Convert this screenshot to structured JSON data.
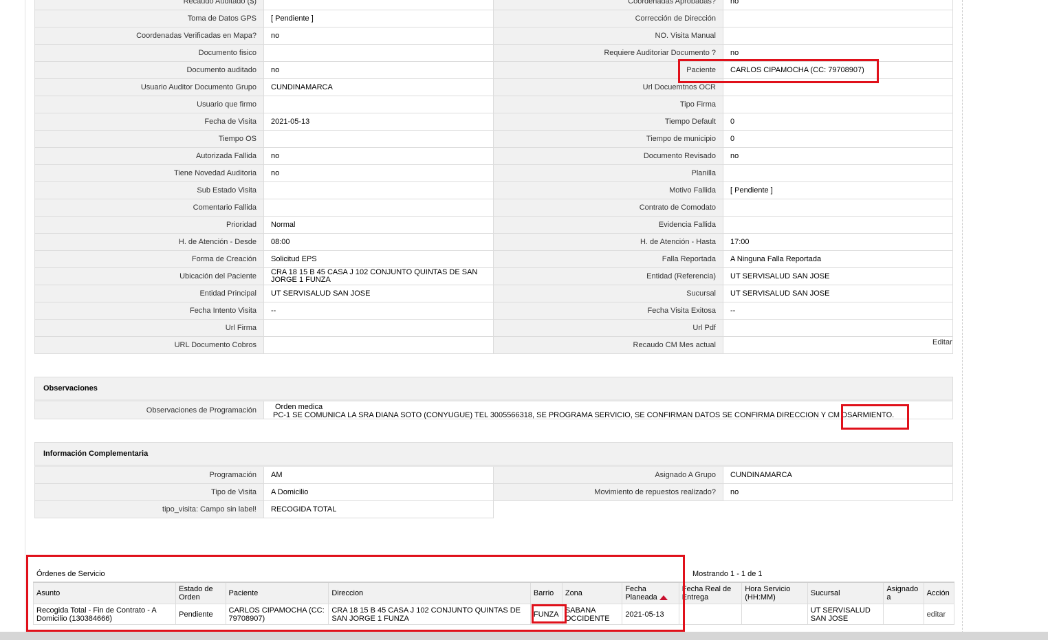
{
  "fields": [
    {
      "l_label": "Recaudo Auditado ($)",
      "l_value": "",
      "r_label": "Coordenadas Aprobadas?",
      "r_value": "no"
    },
    {
      "l_label": "Toma de Datos GPS",
      "l_value": "[ Pendiente ]",
      "r_label": "Corrección de Dirección",
      "r_value": ""
    },
    {
      "l_label": "Coordenadas Verificadas en Mapa?",
      "l_value": "no",
      "r_label": "NO. Visita Manual",
      "r_value": ""
    },
    {
      "l_label": "Documento fisico",
      "l_value": "",
      "r_label": "Requiere Auditoriar Documento ?",
      "r_value": "no"
    },
    {
      "l_label": "Documento auditado",
      "l_value": "no",
      "r_label": "Paciente",
      "r_value": "CARLOS CIPAMOCHA (CC: 79708907)"
    },
    {
      "l_label": "Usuario Auditor Documento Grupo",
      "l_value": "CUNDINAMARCA",
      "r_label": "Url Docuemtnos OCR",
      "r_value": ""
    },
    {
      "l_label": "Usuario que firmo",
      "l_value": "",
      "r_label": "Tipo Firma",
      "r_value": ""
    },
    {
      "l_label": "Fecha de Visita",
      "l_value": "2021-05-13",
      "r_label": "Tiempo Default",
      "r_value": "0"
    },
    {
      "l_label": "Tiempo OS",
      "l_value": "",
      "r_label": "Tiempo de municipio",
      "r_value": "0"
    },
    {
      "l_label": "Autorizada Fallida",
      "l_value": "no",
      "r_label": "Documento Revisado",
      "r_value": "no"
    },
    {
      "l_label": "Tiene Novedad Auditoria",
      "l_value": "no",
      "r_label": "Planilla",
      "r_value": ""
    },
    {
      "l_label": "Sub Estado Visita",
      "l_value": "",
      "r_label": "Motivo Fallida",
      "r_value": "[ Pendiente ]"
    },
    {
      "l_label": "Comentario Fallida",
      "l_value": "",
      "r_label": "Contrato de Comodato",
      "r_value": ""
    },
    {
      "l_label": "Prioridad",
      "l_value": "Normal",
      "r_label": "Evidencia Fallida",
      "r_value": ""
    },
    {
      "l_label": "H. de Atención - Desde",
      "l_value": "08:00",
      "r_label": "H. de Atención - Hasta",
      "r_value": "17:00"
    },
    {
      "l_label": "Forma de Creación",
      "l_value": "Solicitud EPS",
      "r_label": "Falla Reportada",
      "r_value": "A Ninguna Falla Reportada"
    },
    {
      "l_label": "Ubicación del Paciente",
      "l_value": "CRA 18 15 B 45 CASA J 102 CONJUNTO QUINTAS DE SAN JORGE 1 FUNZA",
      "r_label": "Entidad (Referencia)",
      "r_value": "UT SERVISALUD SAN JOSE"
    },
    {
      "l_label": "Entidad Principal",
      "l_value": "UT SERVISALUD SAN JOSE",
      "r_label": "Sucursal",
      "r_value": "UT SERVISALUD SAN JOSE"
    },
    {
      "l_label": "Fecha Intento Visita",
      "l_value": "--",
      "r_label": "Fecha Visita Exitosa",
      "r_value": "--"
    },
    {
      "l_label": "Url Firma",
      "l_value": "",
      "r_label": "Url Pdf",
      "r_value": ""
    },
    {
      "l_label": "URL Documento Cobros",
      "l_value": "",
      "r_label": "Recaudo CM Mes actual",
      "r_value": ""
    }
  ],
  "edit_label": "Editar",
  "observaciones": {
    "title": "Observaciones",
    "label": "Observaciones de Programación",
    "line1": "Orden medica",
    "line2": "PC-1 SE COMUNICA LA SRA DIANA SOTO (CONYUGUE) TEL 3005566318, SE PROGRAMA SERVICIO, SE CONFIRMAN DATOS SE CONFIRMA DIRECCION Y CM DSARMIENTO."
  },
  "info": {
    "title": "Información Complementaria",
    "rows": [
      {
        "l_label": "Programación",
        "l_value": "AM",
        "r_label": "Asignado A Grupo",
        "r_value": "CUNDINAMARCA"
      },
      {
        "l_label": "Tipo de Visita",
        "l_value": "A Domicilio",
        "r_label": "Movimiento de repuestos realizado?",
        "r_value": "no"
      },
      {
        "l_label": "tipo_visita: Campo sin label!",
        "l_value": "RECOGIDA TOTAL"
      }
    ]
  },
  "orders": {
    "title": "Órdenes de Servicio",
    "count": "Mostrando 1 - 1 de 1",
    "headers": [
      "Asunto",
      "Estado de Orden",
      "Paciente",
      "Direccion",
      "Barrio",
      "Zona",
      "Fecha Planeada",
      "Fecha Real de Entrega",
      "Hora Servicio (HH:MM)",
      "Sucursal",
      "Asignado a",
      "Acción"
    ],
    "row": {
      "asunto": "Recogida Total - Fin de Contrato - A Domicilio (130384666)",
      "estado": "Pendiente",
      "paciente": "CARLOS CIPAMOCHA (CC: 79708907)",
      "direccion": "CRA 18 15 B 45 CASA J 102 CONJUNTO QUINTAS DE SAN JORGE 1 FUNZA",
      "barrio": "FUNZA",
      "zona": "SABANA OCCIDENTE",
      "fecha_planeada": "2021-05-13",
      "fecha_real": "",
      "hora": "",
      "sucursal": "UT SERVISALUD SAN JOSE",
      "asignado": "",
      "accion": "editar"
    }
  }
}
